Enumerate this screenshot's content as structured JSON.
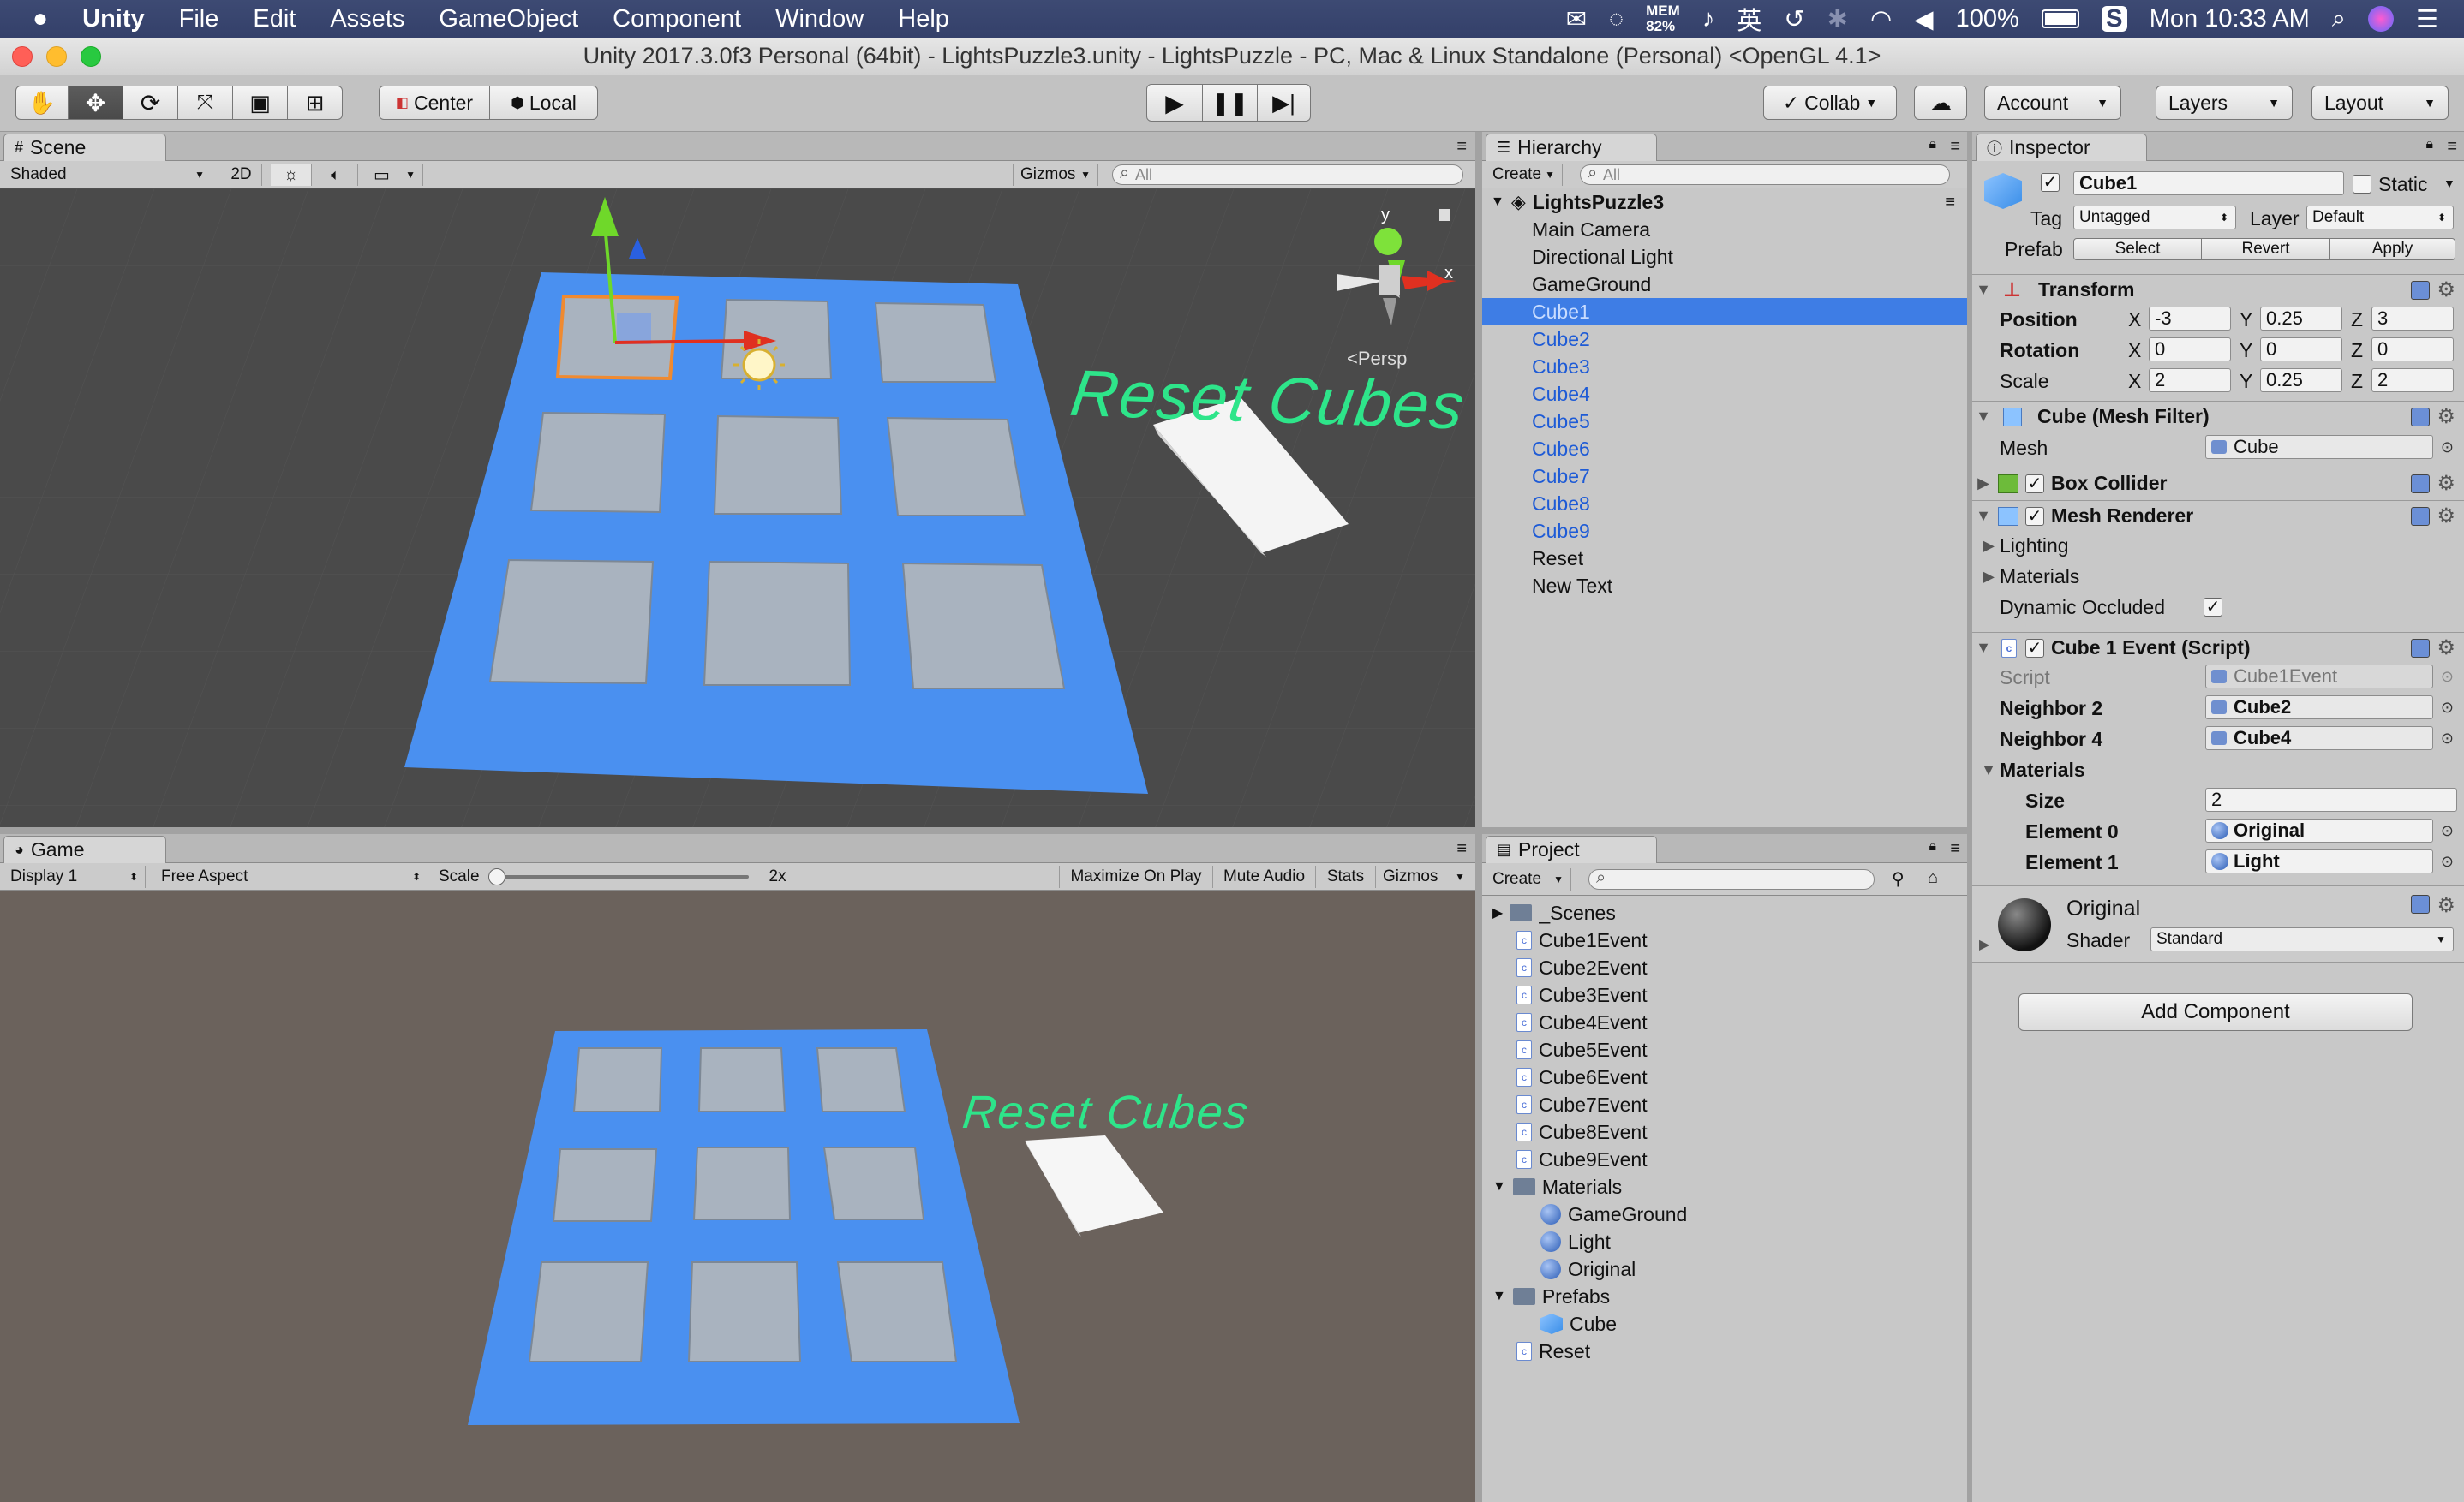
{
  "menubar": {
    "app_name": "Unity",
    "items": [
      "File",
      "Edit",
      "Assets",
      "GameObject",
      "Component",
      "Window",
      "Help"
    ],
    "mem_label": "MEM",
    "mem_value": "82%",
    "ime_label": "英",
    "battery": "100%",
    "clock": "Mon 10:33 AM"
  },
  "window": {
    "title": "Unity 2017.3.0f3 Personal (64bit) - LightsPuzzle3.unity - LightsPuzzle - PC, Mac & Linux Standalone (Personal) <OpenGL 4.1>"
  },
  "toolbar": {
    "pivot_label": "Center",
    "space_label": "Local",
    "collab_label": "Collab",
    "account_label": "Account",
    "layers_label": "Layers",
    "layout_label": "Layout"
  },
  "scene": {
    "tab_label": "Scene",
    "shading_mode": "Shaded",
    "mode_2d": "2D",
    "gizmos_label": "Gizmos",
    "search_placeholder": "All",
    "persp_label": "Persp",
    "gizmo_y": "y",
    "gizmo_x": "x",
    "reset_text": "Reset Cubes"
  },
  "game": {
    "tab_label": "Game",
    "display": "Display 1",
    "aspect": "Free Aspect",
    "scale_label": "Scale",
    "scale_value": "2x",
    "maximize_label": "Maximize On Play",
    "mute_label": "Mute Audio",
    "stats_label": "Stats",
    "gizmos_label": "Gizmos",
    "reset_text": "Reset Cubes"
  },
  "hierarchy": {
    "tab_label": "Hierarchy",
    "create_label": "Create",
    "search_placeholder": "All",
    "scene_name": "LightsPuzzle3",
    "items": [
      "Main Camera",
      "Directional Light",
      "GameGround",
      "Cube1",
      "Cube2",
      "Cube3",
      "Cube4",
      "Cube5",
      "Cube6",
      "Cube7",
      "Cube8",
      "Cube9",
      "Reset",
      "New Text"
    ]
  },
  "project": {
    "tab_label": "Project",
    "create_label": "Create",
    "scenes_folder": "_Scenes",
    "scripts": [
      "Cube1Event",
      "Cube2Event",
      "Cube3Event",
      "Cube4Event",
      "Cube5Event",
      "Cube6Event",
      "Cube7Event",
      "Cube8Event",
      "Cube9Event"
    ],
    "materials_folder": "Materials",
    "materials": [
      "GameGround",
      "Light",
      "Original"
    ],
    "prefabs_folder": "Prefabs",
    "prefab_cube": "Cube",
    "reset_script": "Reset"
  },
  "inspector": {
    "tab_label": "Inspector",
    "object_name": "Cube1",
    "static_label": "Static",
    "tag_label": "Tag",
    "tag_value": "Untagged",
    "layer_label": "Layer",
    "layer_value": "Default",
    "prefab_label": "Prefab",
    "prefab_select": "Select",
    "prefab_revert": "Revert",
    "prefab_apply": "Apply",
    "transform": {
      "title": "Transform",
      "position_label": "Position",
      "rotation_label": "Rotation",
      "scale_label": "Scale",
      "x_label": "X",
      "y_label": "Y",
      "z_label": "Z",
      "position": [
        "-3",
        "0.25",
        "3"
      ],
      "rotation": [
        "0",
        "0",
        "0"
      ],
      "scale": [
        "2",
        "0.25",
        "2"
      ]
    },
    "mesh_filter": {
      "title": "Cube (Mesh Filter)",
      "mesh_label": "Mesh",
      "mesh_value": "Cube"
    },
    "box_collider": {
      "title": "Box Collider"
    },
    "mesh_renderer": {
      "title": "Mesh Renderer",
      "lighting_label": "Lighting",
      "materials_label": "Materials",
      "dynamic_label": "Dynamic Occluded"
    },
    "script": {
      "title": "Cube 1 Event (Script)",
      "script_label": "Script",
      "script_value": "Cube1Event",
      "neighbor2_label": "Neighbor 2",
      "neighbor2_value": "Cube2",
      "neighbor4_label": "Neighbor 4",
      "neighbor4_value": "Cube4",
      "materials_label": "Materials",
      "size_label": "Size",
      "size_value": "2",
      "element0_label": "Element 0",
      "element0_value": "Original",
      "element1_label": "Element 1",
      "element1_value": "Light"
    },
    "material": {
      "name": "Original",
      "shader_label": "Shader",
      "shader_value": "Standard"
    },
    "add_component_label": "Add Component"
  },
  "colors": {
    "selection": "#3e7de5",
    "board": "#4a90f0",
    "tile": "#a9b3bf",
    "reset_text": "#2ee58a"
  }
}
